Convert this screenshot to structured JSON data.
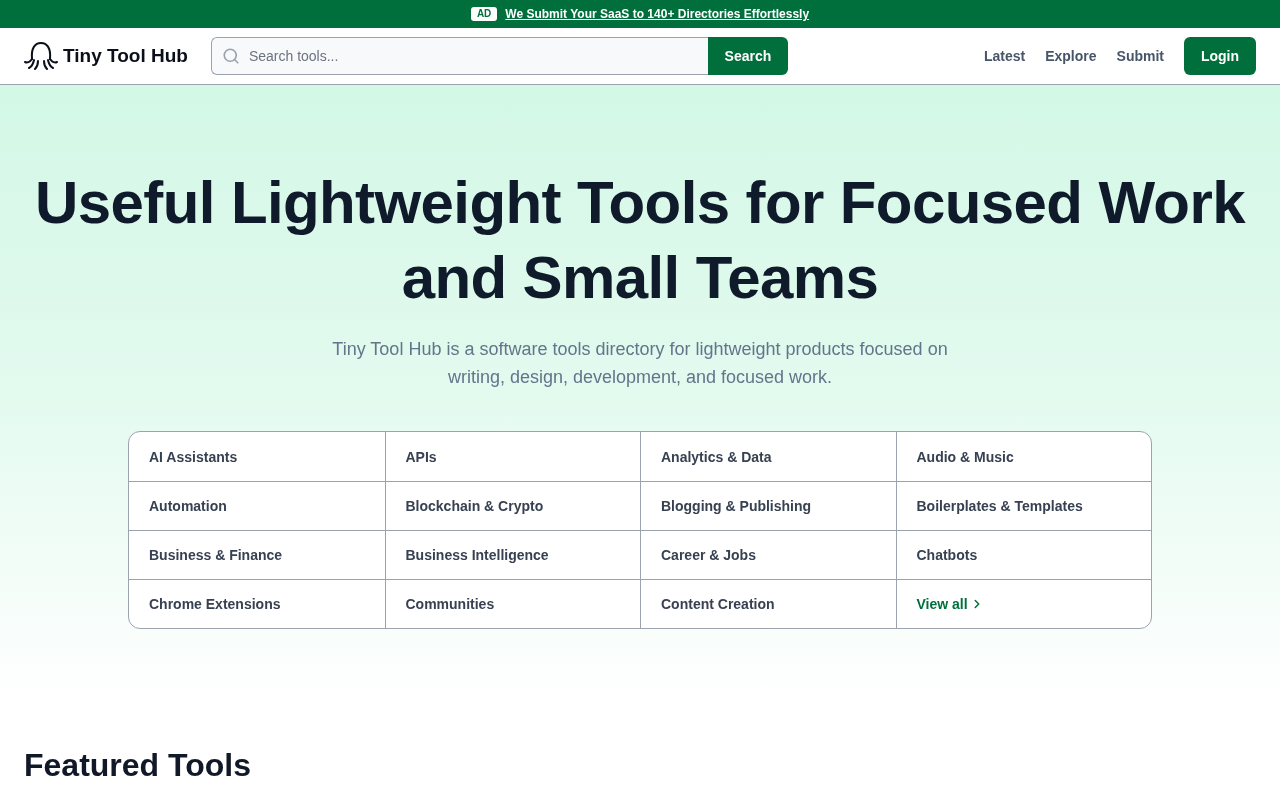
{
  "banner": {
    "badge": "AD",
    "link": "We Submit Your SaaS to 140+ Directories Effortlessly"
  },
  "header": {
    "logo": "Tiny Tool Hub",
    "search": {
      "placeholder": "Search tools...",
      "button": "Search"
    },
    "nav": [
      "Latest",
      "Explore",
      "Submit"
    ],
    "login": "Login"
  },
  "hero": {
    "title": "Useful Lightweight Tools for Focused Work and Small Teams",
    "subtitle": "Tiny Tool Hub is a software tools directory for lightweight products focused on writing, design, development, and focused work."
  },
  "categories": [
    {
      "kind": "category",
      "label": "AI Assistants"
    },
    {
      "kind": "category",
      "label": "APIs"
    },
    {
      "kind": "category",
      "label": "Analytics & Data"
    },
    {
      "kind": "category",
      "label": "Audio & Music"
    },
    {
      "kind": "category",
      "label": "Automation"
    },
    {
      "kind": "category",
      "label": "Blockchain & Crypto"
    },
    {
      "kind": "category",
      "label": "Blogging & Publishing"
    },
    {
      "kind": "category",
      "label": "Boilerplates & Templates"
    },
    {
      "kind": "category",
      "label": "Business & Finance"
    },
    {
      "kind": "category",
      "label": "Business Intelligence"
    },
    {
      "kind": "category",
      "label": "Career & Jobs"
    },
    {
      "kind": "category",
      "label": "Chatbots"
    },
    {
      "kind": "category",
      "label": "Chrome Extensions"
    },
    {
      "kind": "category",
      "label": "Communities"
    },
    {
      "kind": "category",
      "label": "Content Creation"
    },
    {
      "kind": "more",
      "label": "View all"
    }
  ],
  "featured": {
    "heading": "Featured Tools"
  }
}
